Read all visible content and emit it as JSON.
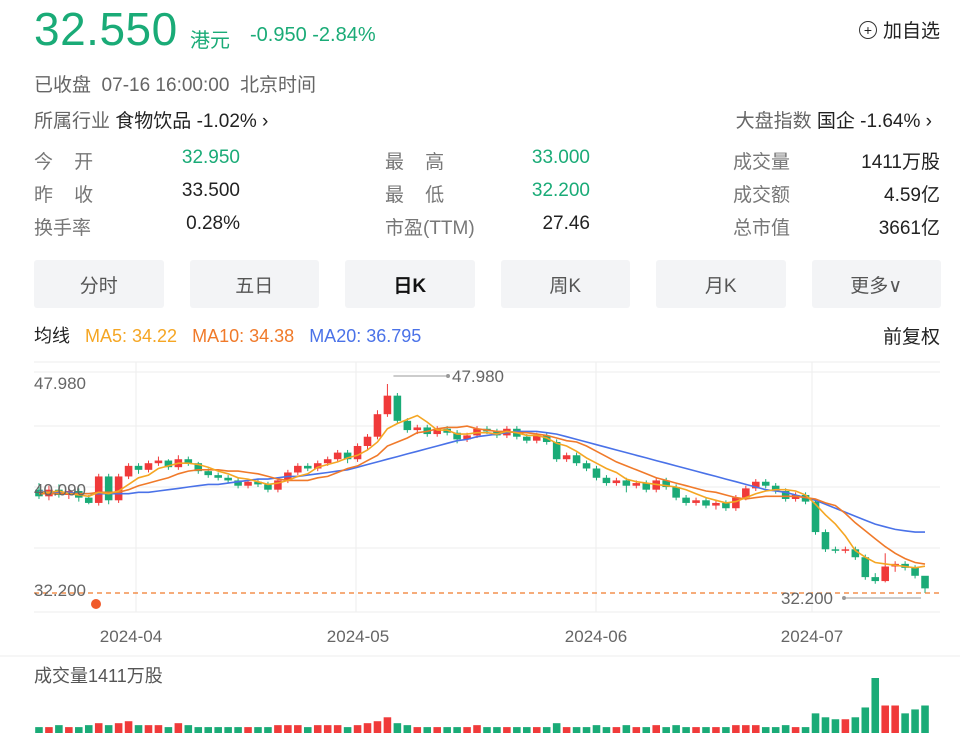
{
  "quote": {
    "price": "32.550",
    "currency": "港元",
    "change": "-0.950 -2.84%",
    "watchlist_label": "加自选",
    "status": "已收盘  07-16 16:00:00  北京时间",
    "industry_label": "所属行业",
    "industry_value": "食物饮品 -1.02% ›",
    "index_label": "大盘指数",
    "index_value": "国企 -1.64% ›"
  },
  "stats": [
    {
      "label": "今    开",
      "value": "32.950",
      "color": "#1aab77"
    },
    {
      "label": "昨    收",
      "value": "33.500",
      "color": "#222222"
    },
    {
      "label": "换手率",
      "value": "0.28%",
      "color": "#222222"
    },
    {
      "label": "最    高",
      "value": "33.000",
      "color": "#1aab77"
    },
    {
      "label": "最    低",
      "value": "32.200",
      "color": "#1aab77"
    },
    {
      "label": "市盈(TTM)",
      "value": "27.46",
      "color": "#222222"
    },
    {
      "label": "成交量",
      "value": "1411万股",
      "color": "#222222"
    },
    {
      "label": "成交额",
      "value": "4.59亿",
      "color": "#222222"
    },
    {
      "label": "总市值",
      "value": "3661亿",
      "color": "#222222"
    }
  ],
  "tabs": [
    "分时",
    "五日",
    "日K",
    "周K",
    "月K",
    "更多∨"
  ],
  "active_tab": "日K",
  "ma": {
    "label": "均线",
    "ma5": "MA5: 34.22",
    "ma10": "MA10: 34.38",
    "ma20": "MA20: 36.795",
    "adjust": "前复权"
  },
  "volume_label": "成交量1411万股",
  "colors": {
    "up": "#f03a3a",
    "down": "#1aab77",
    "ma5": "#f5a623",
    "ma10": "#f07a2a",
    "ma20": "#4a72e8"
  },
  "chart_data": {
    "type": "candlestick",
    "y_axis_labels": [
      "47.980",
      "40.090",
      "32.200"
    ],
    "ylim": [
      32.2,
      47.98
    ],
    "x_ticks": [
      "2024-04",
      "2024-05",
      "2024-06",
      "2024-07"
    ],
    "annotations": {
      "high": "47.980",
      "low": "32.200"
    },
    "candles": [
      [
        40.0,
        39.5,
        40.5,
        39.3
      ],
      [
        39.5,
        40.0,
        40.3,
        39.2
      ],
      [
        40.0,
        39.6,
        40.4,
        39.4
      ],
      [
        39.6,
        39.9,
        40.2,
        39.3
      ],
      [
        39.9,
        39.4,
        40.1,
        39.1
      ],
      [
        39.4,
        39.0,
        39.6,
        38.9
      ],
      [
        39.0,
        41.0,
        41.2,
        38.8
      ],
      [
        41.0,
        39.2,
        41.2,
        38.9
      ],
      [
        39.2,
        41.0,
        41.2,
        39.0
      ],
      [
        41.0,
        41.8,
        42.0,
        40.8
      ],
      [
        41.8,
        41.5,
        42.0,
        41.2
      ],
      [
        41.5,
        42.0,
        42.2,
        41.3
      ],
      [
        42.0,
        42.2,
        42.5,
        41.8
      ],
      [
        42.2,
        41.7,
        42.3,
        41.5
      ],
      [
        41.7,
        42.3,
        42.6,
        41.5
      ],
      [
        42.3,
        42.0,
        42.5,
        41.8
      ],
      [
        42.0,
        41.4,
        42.1,
        41.2
      ],
      [
        41.4,
        41.1,
        41.6,
        40.9
      ],
      [
        41.1,
        40.9,
        41.3,
        40.7
      ],
      [
        40.9,
        40.7,
        41.1,
        40.5
      ],
      [
        40.7,
        40.3,
        40.9,
        40.1
      ],
      [
        40.3,
        40.6,
        40.8,
        40.1
      ],
      [
        40.6,
        40.4,
        40.8,
        40.2
      ],
      [
        40.4,
        40.0,
        40.6,
        39.8
      ],
      [
        40.0,
        40.7,
        40.9,
        39.8
      ],
      [
        40.7,
        41.3,
        41.5,
        40.5
      ],
      [
        41.3,
        41.8,
        42.0,
        41.1
      ],
      [
        41.8,
        41.6,
        42.0,
        41.4
      ],
      [
        41.6,
        42.0,
        42.2,
        41.4
      ],
      [
        42.0,
        42.3,
        42.5,
        41.8
      ],
      [
        42.3,
        42.8,
        43.0,
        42.1
      ],
      [
        42.8,
        42.3,
        43.0,
        42.0
      ],
      [
        42.3,
        43.3,
        43.5,
        42.1
      ],
      [
        43.3,
        44.0,
        44.2,
        43.0
      ],
      [
        44.0,
        45.7,
        46.0,
        43.8
      ],
      [
        45.7,
        47.1,
        47.98,
        45.5
      ],
      [
        47.1,
        45.2,
        47.3,
        45.0
      ],
      [
        45.2,
        44.5,
        45.4,
        44.3
      ],
      [
        44.5,
        44.7,
        44.9,
        44.2
      ],
      [
        44.7,
        44.2,
        44.9,
        44.0
      ],
      [
        44.2,
        44.6,
        44.8,
        44.0
      ],
      [
        44.6,
        44.3,
        44.8,
        44.1
      ],
      [
        44.3,
        43.8,
        44.5,
        43.5
      ],
      [
        43.8,
        44.1,
        44.3,
        43.6
      ],
      [
        44.1,
        44.6,
        44.8,
        43.9
      ],
      [
        44.6,
        44.4,
        44.8,
        44.2
      ],
      [
        44.4,
        44.1,
        44.6,
        43.9
      ],
      [
        44.1,
        44.6,
        44.8,
        43.9
      ],
      [
        44.6,
        44.0,
        44.8,
        43.8
      ],
      [
        44.0,
        43.7,
        44.2,
        43.5
      ],
      [
        43.7,
        44.1,
        44.3,
        43.5
      ],
      [
        44.1,
        43.6,
        44.3,
        43.4
      ],
      [
        43.6,
        42.3,
        43.8,
        42.1
      ],
      [
        42.3,
        42.6,
        42.8,
        42.1
      ],
      [
        42.6,
        42.0,
        42.8,
        41.8
      ],
      [
        42.0,
        41.6,
        42.2,
        41.4
      ],
      [
        41.6,
        40.9,
        41.8,
        40.7
      ],
      [
        40.9,
        40.5,
        41.1,
        40.3
      ],
      [
        40.5,
        40.7,
        40.9,
        40.3
      ],
      [
        40.7,
        40.3,
        40.9,
        39.8
      ],
      [
        40.3,
        40.5,
        40.7,
        40.1
      ],
      [
        40.5,
        40.0,
        40.7,
        39.8
      ],
      [
        40.0,
        40.7,
        40.9,
        39.8
      ],
      [
        40.7,
        40.2,
        40.9,
        40.0
      ],
      [
        40.2,
        39.4,
        40.4,
        39.2
      ],
      [
        39.4,
        39.0,
        39.6,
        38.8
      ],
      [
        39.0,
        39.2,
        39.4,
        38.8
      ],
      [
        39.2,
        38.8,
        39.4,
        38.6
      ],
      [
        38.8,
        39.0,
        39.2,
        38.5
      ],
      [
        39.0,
        38.6,
        39.2,
        38.4
      ],
      [
        38.6,
        39.4,
        39.6,
        38.4
      ],
      [
        39.4,
        40.1,
        40.3,
        39.2
      ],
      [
        40.1,
        40.6,
        40.8,
        39.9
      ],
      [
        40.6,
        40.3,
        40.8,
        40.1
      ],
      [
        40.3,
        39.9,
        40.5,
        39.7
      ],
      [
        39.9,
        39.3,
        40.1,
        39.1
      ],
      [
        39.3,
        39.6,
        39.8,
        39.1
      ],
      [
        39.6,
        39.1,
        39.8,
        38.9
      ],
      [
        39.1,
        36.8,
        39.3,
        36.6
      ],
      [
        36.8,
        35.5,
        37.0,
        35.3
      ],
      [
        35.5,
        35.4,
        35.7,
        35.2
      ],
      [
        35.4,
        35.5,
        35.7,
        35.2
      ],
      [
        35.5,
        34.9,
        35.7,
        34.7
      ],
      [
        34.9,
        33.4,
        35.1,
        33.2
      ],
      [
        33.4,
        33.1,
        33.7,
        32.9
      ],
      [
        33.1,
        34.2,
        35.2,
        33.0
      ],
      [
        34.2,
        34.4,
        34.6,
        33.8
      ],
      [
        34.4,
        34.1,
        34.6,
        33.9
      ],
      [
        34.1,
        33.5,
        34.3,
        33.3
      ],
      [
        33.5,
        32.55,
        33.0,
        32.2
      ]
    ],
    "ma5": [
      39.8,
      39.8,
      39.9,
      39.7,
      39.6,
      39.5,
      39.8,
      39.7,
      39.9,
      40.4,
      40.9,
      41.1,
      41.6,
      41.8,
      42.0,
      42.0,
      41.9,
      41.7,
      41.4,
      41.2,
      40.9,
      40.8,
      40.6,
      40.4,
      40.5,
      40.7,
      41.0,
      41.2,
      41.7,
      41.9,
      42.1,
      42.4,
      42.6,
      43.0,
      43.6,
      44.6,
      45.0,
      45.3,
      45.6,
      45.1,
      44.5,
      44.5,
      44.2,
      44.2,
      44.3,
      44.3,
      44.2,
      44.4,
      44.3,
      44.1,
      44.1,
      43.9,
      43.5,
      43.3,
      42.9,
      42.4,
      42.0,
      41.6,
      41.3,
      40.8,
      40.6,
      40.5,
      40.4,
      40.3,
      40.2,
      40.0,
      39.7,
      39.4,
      39.2,
      39.0,
      39.1,
      39.4,
      39.7,
      39.9,
      40.0,
      40.0,
      39.9,
      39.6,
      38.9,
      38.1,
      37.4,
      36.5,
      35.4,
      34.9,
      34.5,
      34.4,
      34.3,
      34.2,
      34.1,
      34.22
    ],
    "ma10": [
      39.7,
      39.7,
      39.7,
      39.7,
      39.7,
      39.7,
      39.8,
      39.8,
      39.8,
      40.0,
      40.3,
      40.5,
      40.7,
      40.9,
      41.2,
      41.4,
      41.5,
      41.5,
      41.5,
      41.4,
      41.4,
      41.3,
      41.2,
      41.0,
      40.8,
      40.7,
      40.7,
      40.7,
      40.9,
      41.0,
      41.3,
      41.6,
      41.8,
      42.2,
      42.6,
      43.3,
      43.6,
      43.9,
      44.3,
      44.4,
      44.6,
      44.7,
      44.7,
      44.8,
      44.6,
      44.5,
      44.4,
      44.4,
      44.3,
      44.3,
      44.2,
      44.1,
      43.9,
      43.7,
      43.6,
      43.3,
      42.9,
      42.5,
      42.1,
      41.8,
      41.5,
      41.2,
      40.9,
      40.7,
      40.5,
      40.3,
      40.1,
      39.9,
      39.8,
      39.6,
      39.4,
      39.3,
      39.4,
      39.5,
      39.5,
      39.5,
      39.5,
      39.4,
      39.3,
      39.0,
      38.8,
      38.2,
      37.5,
      36.9,
      36.3,
      35.7,
      35.2,
      34.8,
      34.5,
      34.38
    ],
    "ma20": [
      39.9,
      39.8,
      39.8,
      39.8,
      39.7,
      39.7,
      39.7,
      39.7,
      39.7,
      39.7,
      39.8,
      39.8,
      39.9,
      40.0,
      40.1,
      40.2,
      40.3,
      40.4,
      40.4,
      40.5,
      40.6,
      40.7,
      40.8,
      40.8,
      40.9,
      41.0,
      41.0,
      41.1,
      41.2,
      41.3,
      41.4,
      41.5,
      41.7,
      41.9,
      42.1,
      42.3,
      42.5,
      42.7,
      42.9,
      43.1,
      43.3,
      43.5,
      43.7,
      43.8,
      44.0,
      44.1,
      44.2,
      44.3,
      44.4,
      44.4,
      44.4,
      44.3,
      44.2,
      44.0,
      43.8,
      43.6,
      43.4,
      43.2,
      43.0,
      42.8,
      42.6,
      42.4,
      42.2,
      42.0,
      41.8,
      41.6,
      41.4,
      41.2,
      41.0,
      40.8,
      40.6,
      40.4,
      40.2,
      40.0,
      39.9,
      39.8,
      39.6,
      39.4,
      39.2,
      38.9,
      38.6,
      38.3,
      38.0,
      37.7,
      37.4,
      37.2,
      37.0,
      36.9,
      36.8,
      36.795
    ]
  }
}
